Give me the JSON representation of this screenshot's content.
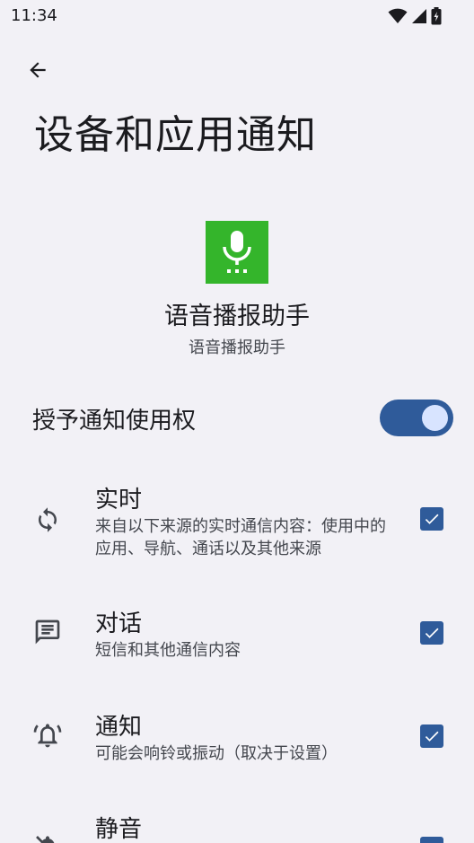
{
  "status_bar": {
    "time": "11:34",
    "icons": [
      "wifi-icon",
      "cellular-signal-icon",
      "battery-charging-icon"
    ]
  },
  "header": {
    "back_icon": "arrow-back-icon",
    "title": "设备和应用通知"
  },
  "app": {
    "icon": "microphone-icon",
    "icon_bg_color": "#34b52b",
    "name": "语音播报助手",
    "package": "语音播报助手"
  },
  "grant": {
    "label": "授予通知使用权",
    "enabled": true
  },
  "categories": [
    {
      "icon": "sync-icon",
      "title": "实时",
      "description": "来自以下来源的实时通信内容：使用中的应用、导航、通话以及其他来源",
      "checked": true
    },
    {
      "icon": "message-icon",
      "title": "对话",
      "description": "短信和其他通信内容",
      "checked": true
    },
    {
      "icon": "bell-ringing-icon",
      "title": "通知",
      "description": "可能会响铃或振动（取决于设置）",
      "checked": true
    },
    {
      "icon": "bell-off-icon",
      "title": "静音",
      "description": "",
      "checked": true
    }
  ],
  "colors": {
    "accent": "#2f5b9a",
    "background": "#f2f1f6"
  }
}
